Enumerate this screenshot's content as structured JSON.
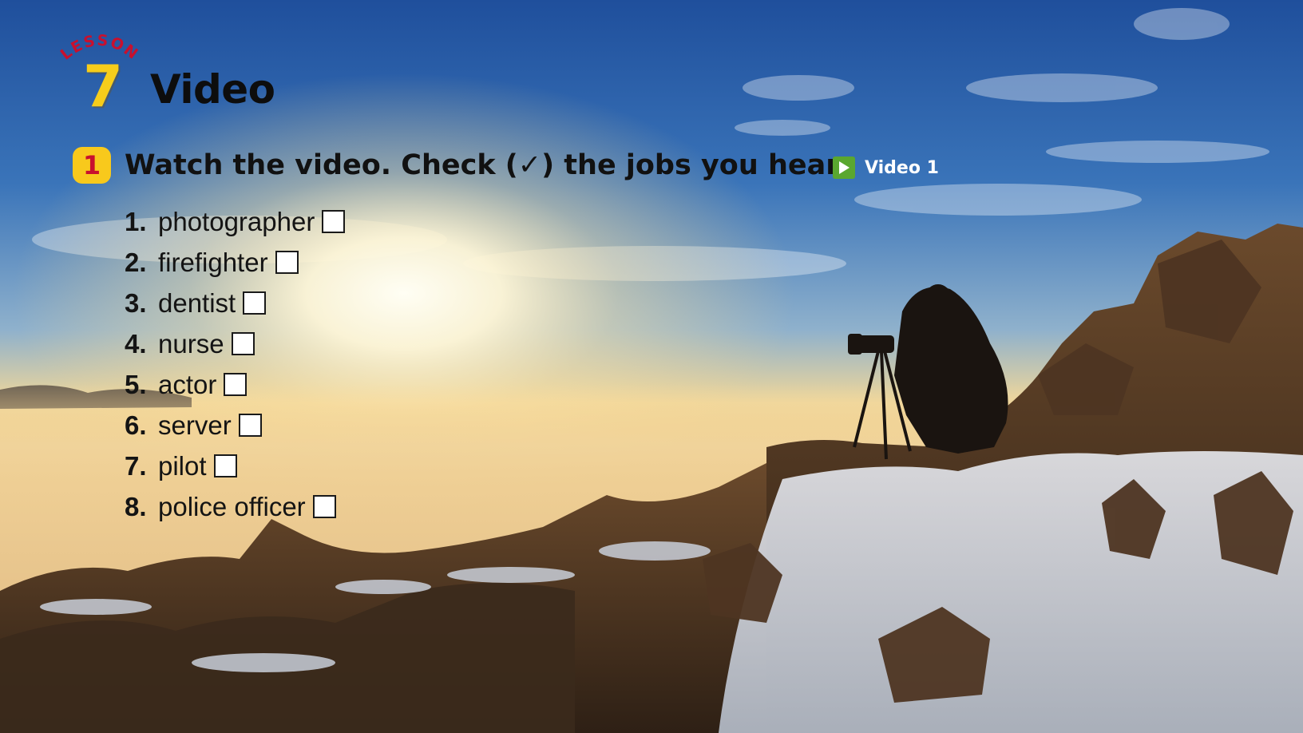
{
  "header": {
    "lesson_word": "LESSON",
    "lesson_number": "7",
    "title": "Video"
  },
  "activity": {
    "number": "1",
    "instruction": "Watch the video. Check (✓) the jobs you hear.",
    "video_label": "Video 1",
    "play_icon": "play-icon"
  },
  "jobs": [
    {
      "num": "1.",
      "label": "photographer",
      "checked": false
    },
    {
      "num": "2.",
      "label": "firefighter",
      "checked": false
    },
    {
      "num": "3.",
      "label": "dentist",
      "checked": false
    },
    {
      "num": "4.",
      "label": "nurse",
      "checked": false
    },
    {
      "num": "5.",
      "label": "actor",
      "checked": false
    },
    {
      "num": "6.",
      "label": "server",
      "checked": false
    },
    {
      "num": "7.",
      "label": "pilot",
      "checked": false
    },
    {
      "num": "8.",
      "label": "police officer",
      "checked": false
    }
  ],
  "colors": {
    "lesson_red": "#c8102e",
    "lesson_yellow": "#f6cd1b",
    "badge_yellow": "#f8c91c",
    "play_green": "#5aa72f"
  }
}
